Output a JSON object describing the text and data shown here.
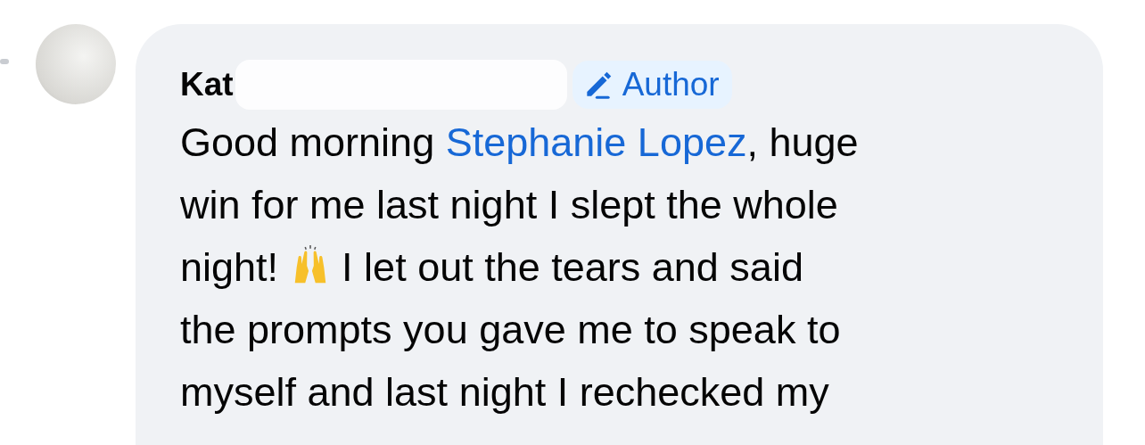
{
  "comment": {
    "author": "Kat",
    "badge": "Author",
    "body": [
      {
        "kind": "text",
        "text": "Good morning "
      },
      {
        "kind": "mention",
        "text": "Stephanie Lopez"
      },
      {
        "kind": "text",
        "text": ", huge"
      },
      {
        "kind": "break"
      },
      {
        "kind": "text",
        "text": "win for me last night I slept the whole"
      },
      {
        "kind": "break"
      },
      {
        "kind": "text",
        "text": "night! "
      },
      {
        "kind": "emoji"
      },
      {
        "kind": "text",
        "text": " I let out the tears and said"
      },
      {
        "kind": "break"
      },
      {
        "kind": "text",
        "text": "the prompts you gave me to speak to"
      },
      {
        "kind": "break"
      },
      {
        "kind": "text",
        "text": "myself and last night I rechecked my"
      }
    ]
  }
}
